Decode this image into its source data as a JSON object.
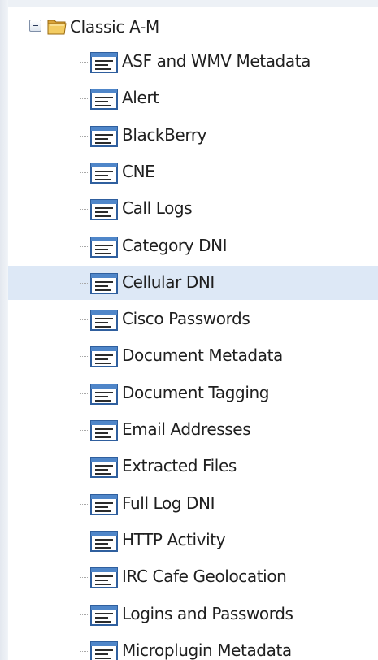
{
  "tree": {
    "root": {
      "label": "Classic A-M",
      "expander_icon": "minus-box-icon",
      "folder_icon": "folder-open-icon"
    },
    "selected_index": 6,
    "selection_color": "#dde8f6",
    "items": [
      {
        "label": "ASF and WMV Metadata",
        "icon": "report-icon"
      },
      {
        "label": "Alert",
        "icon": "report-icon"
      },
      {
        "label": "BlackBerry",
        "icon": "report-icon"
      },
      {
        "label": "CNE",
        "icon": "report-icon"
      },
      {
        "label": "Call Logs",
        "icon": "report-icon"
      },
      {
        "label": "Category DNI",
        "icon": "report-icon"
      },
      {
        "label": "Cellular DNI",
        "icon": "report-icon"
      },
      {
        "label": "Cisco Passwords",
        "icon": "report-icon"
      },
      {
        "label": "Document Metadata",
        "icon": "report-icon"
      },
      {
        "label": "Document Tagging",
        "icon": "report-icon"
      },
      {
        "label": "Email Addresses",
        "icon": "report-icon"
      },
      {
        "label": "Extracted Files",
        "icon": "report-icon"
      },
      {
        "label": "Full Log DNI",
        "icon": "report-icon"
      },
      {
        "label": "HTTP Activity",
        "icon": "report-icon"
      },
      {
        "label": "IRC Cafe Geolocation",
        "icon": "report-icon"
      },
      {
        "label": "Logins and Passwords",
        "icon": "report-icon"
      },
      {
        "label": "Microplugin Metadata",
        "icon": "report-icon"
      }
    ]
  }
}
